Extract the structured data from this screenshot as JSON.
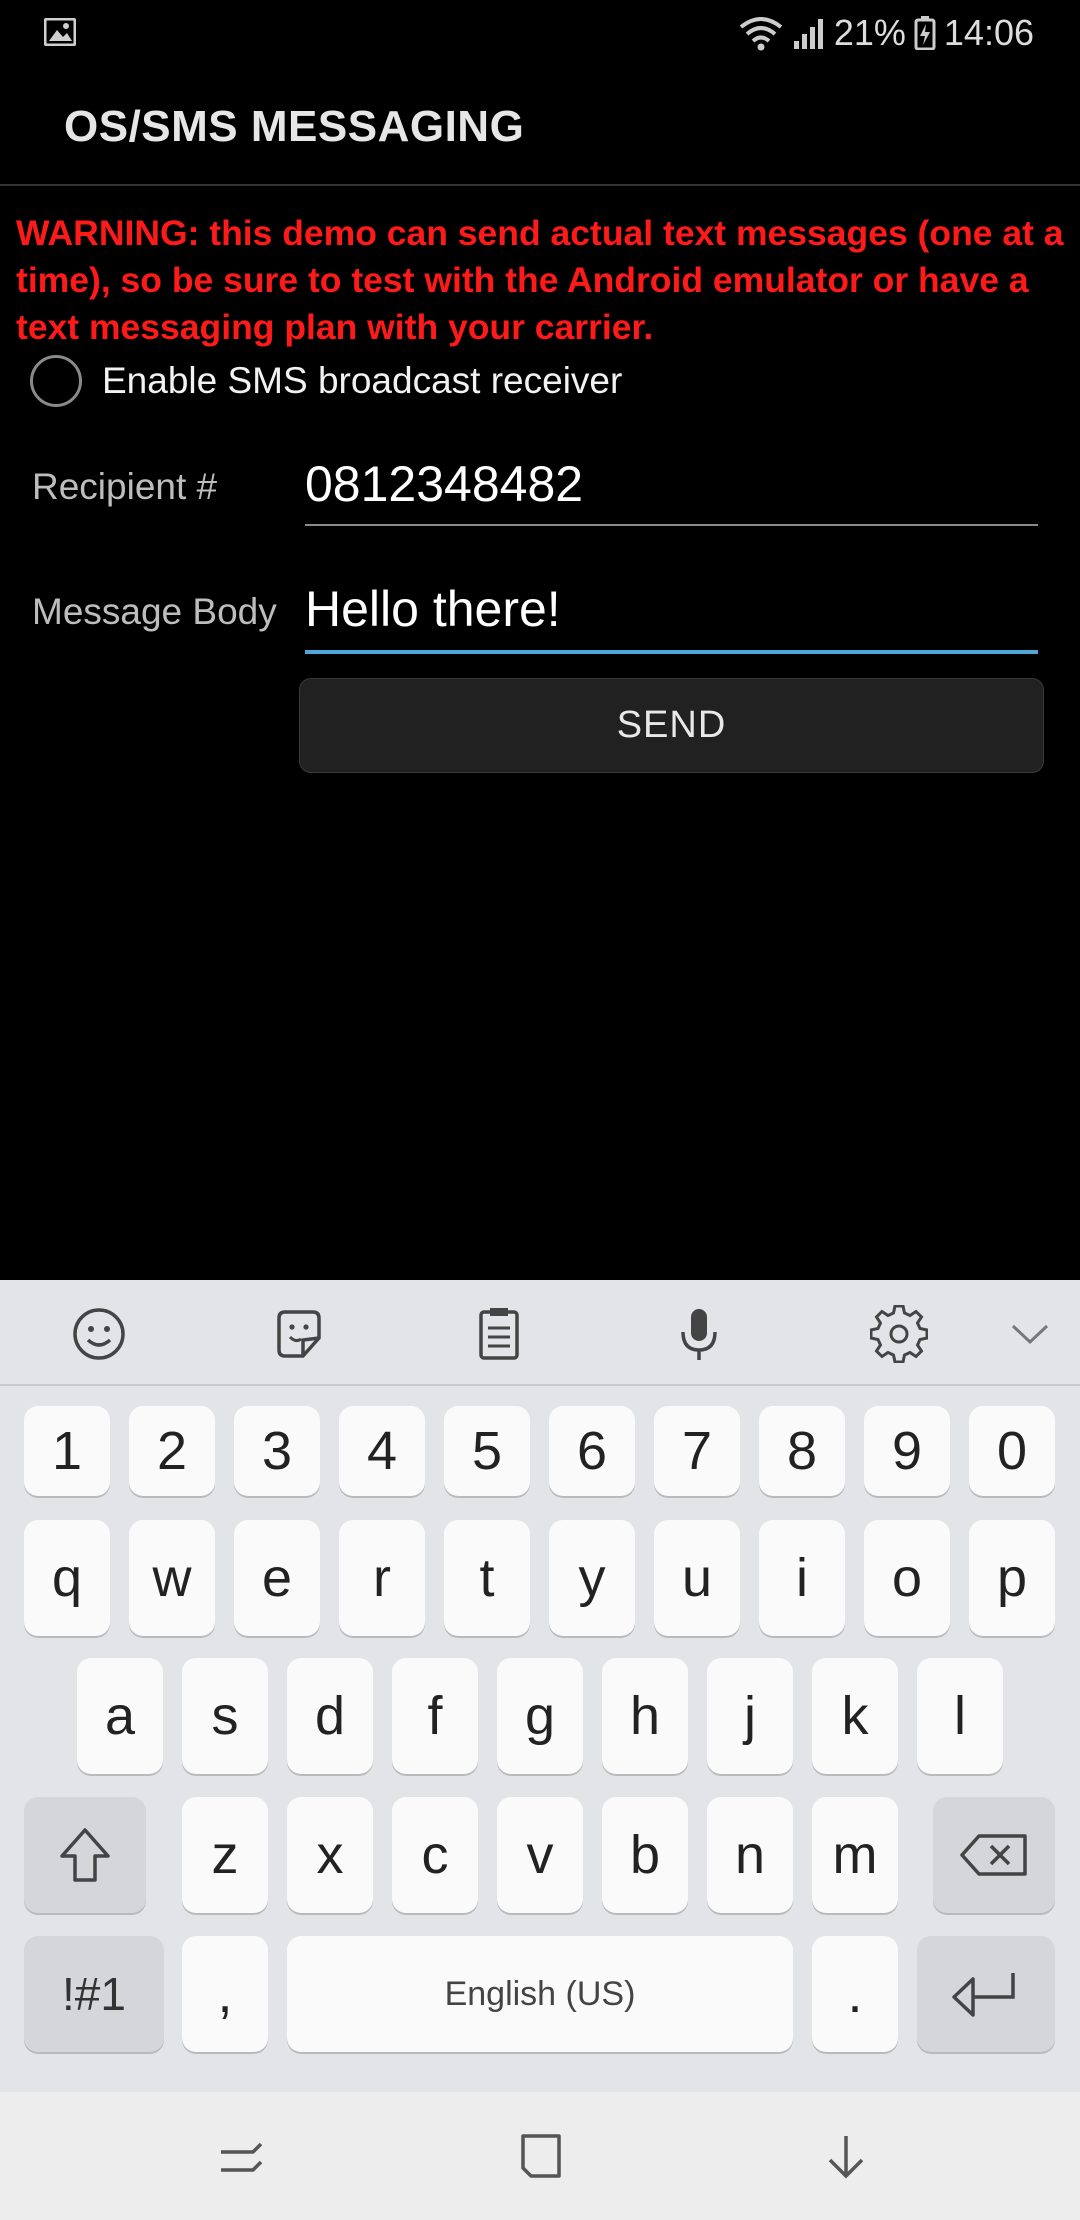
{
  "status_bar": {
    "battery_percent": "21%",
    "time": "14:06",
    "icons": [
      "image-icon",
      "wifi-icon",
      "signal-icon",
      "battery-icon"
    ]
  },
  "app_bar": {
    "title": "OS/SMS MESSAGING"
  },
  "warning": {
    "text": "WARNING: this demo can send actual text messages (one at a time), so be sure to test with the Android emulator or have a text messaging plan with your carrier.",
    "color": "#ff1a1a"
  },
  "broadcast_checkbox": {
    "label": "Enable SMS broadcast receiver",
    "checked": false
  },
  "form": {
    "recipient_label": "Recipient #",
    "recipient_value": "0812348482",
    "message_label": "Message Body",
    "message_value": "Hello there!",
    "send_label": "SEND",
    "focus_color": "#4fa7d9"
  },
  "keyboard": {
    "toolbar_icons": [
      "emoji-icon",
      "sticker-icon",
      "clipboard-icon",
      "microphone-icon",
      "settings-gear-icon",
      "collapse-chevron-icon"
    ],
    "number_row": [
      "1",
      "2",
      "3",
      "4",
      "5",
      "6",
      "7",
      "8",
      "9",
      "0"
    ],
    "row1": [
      "q",
      "w",
      "e",
      "r",
      "t",
      "y",
      "u",
      "i",
      "o",
      "p"
    ],
    "row2": [
      "a",
      "s",
      "d",
      "f",
      "g",
      "h",
      "j",
      "k",
      "l"
    ],
    "row3": [
      "z",
      "x",
      "c",
      "v",
      "b",
      "n",
      "m"
    ],
    "symbols_label": "!#1",
    "comma_label": ",",
    "space_label": "English (US)",
    "period_label": "."
  },
  "nav_bar": {
    "icons": [
      "recent-apps-icon",
      "home-icon",
      "back-icon"
    ]
  }
}
